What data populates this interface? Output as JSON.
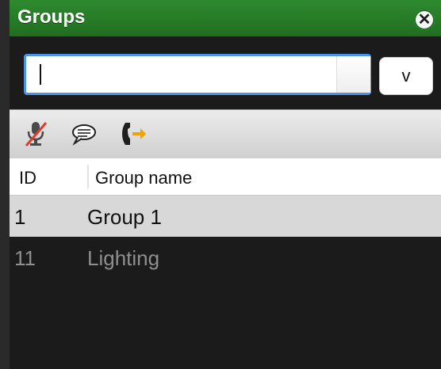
{
  "window": {
    "title": "Groups"
  },
  "search": {
    "value": "",
    "placeholder": "",
    "dropdown_label": "v"
  },
  "toolbar": {
    "icons": [
      "muted-microphone-icon",
      "speech-bubble-icon",
      "phone-exit-icon"
    ]
  },
  "table": {
    "columns": [
      "ID",
      "Group name"
    ],
    "rows": [
      {
        "id": "1",
        "name": "Group 1",
        "selected": true
      },
      {
        "id": "11",
        "name": "Lighting",
        "selected": false
      }
    ]
  },
  "colors": {
    "titlebar": "#2a7f2a",
    "focus_ring": "#4b93e8",
    "selected_row": "#d8d8d8",
    "dim_text": "#8f8f8f",
    "accent_orange": "#f1a400"
  }
}
